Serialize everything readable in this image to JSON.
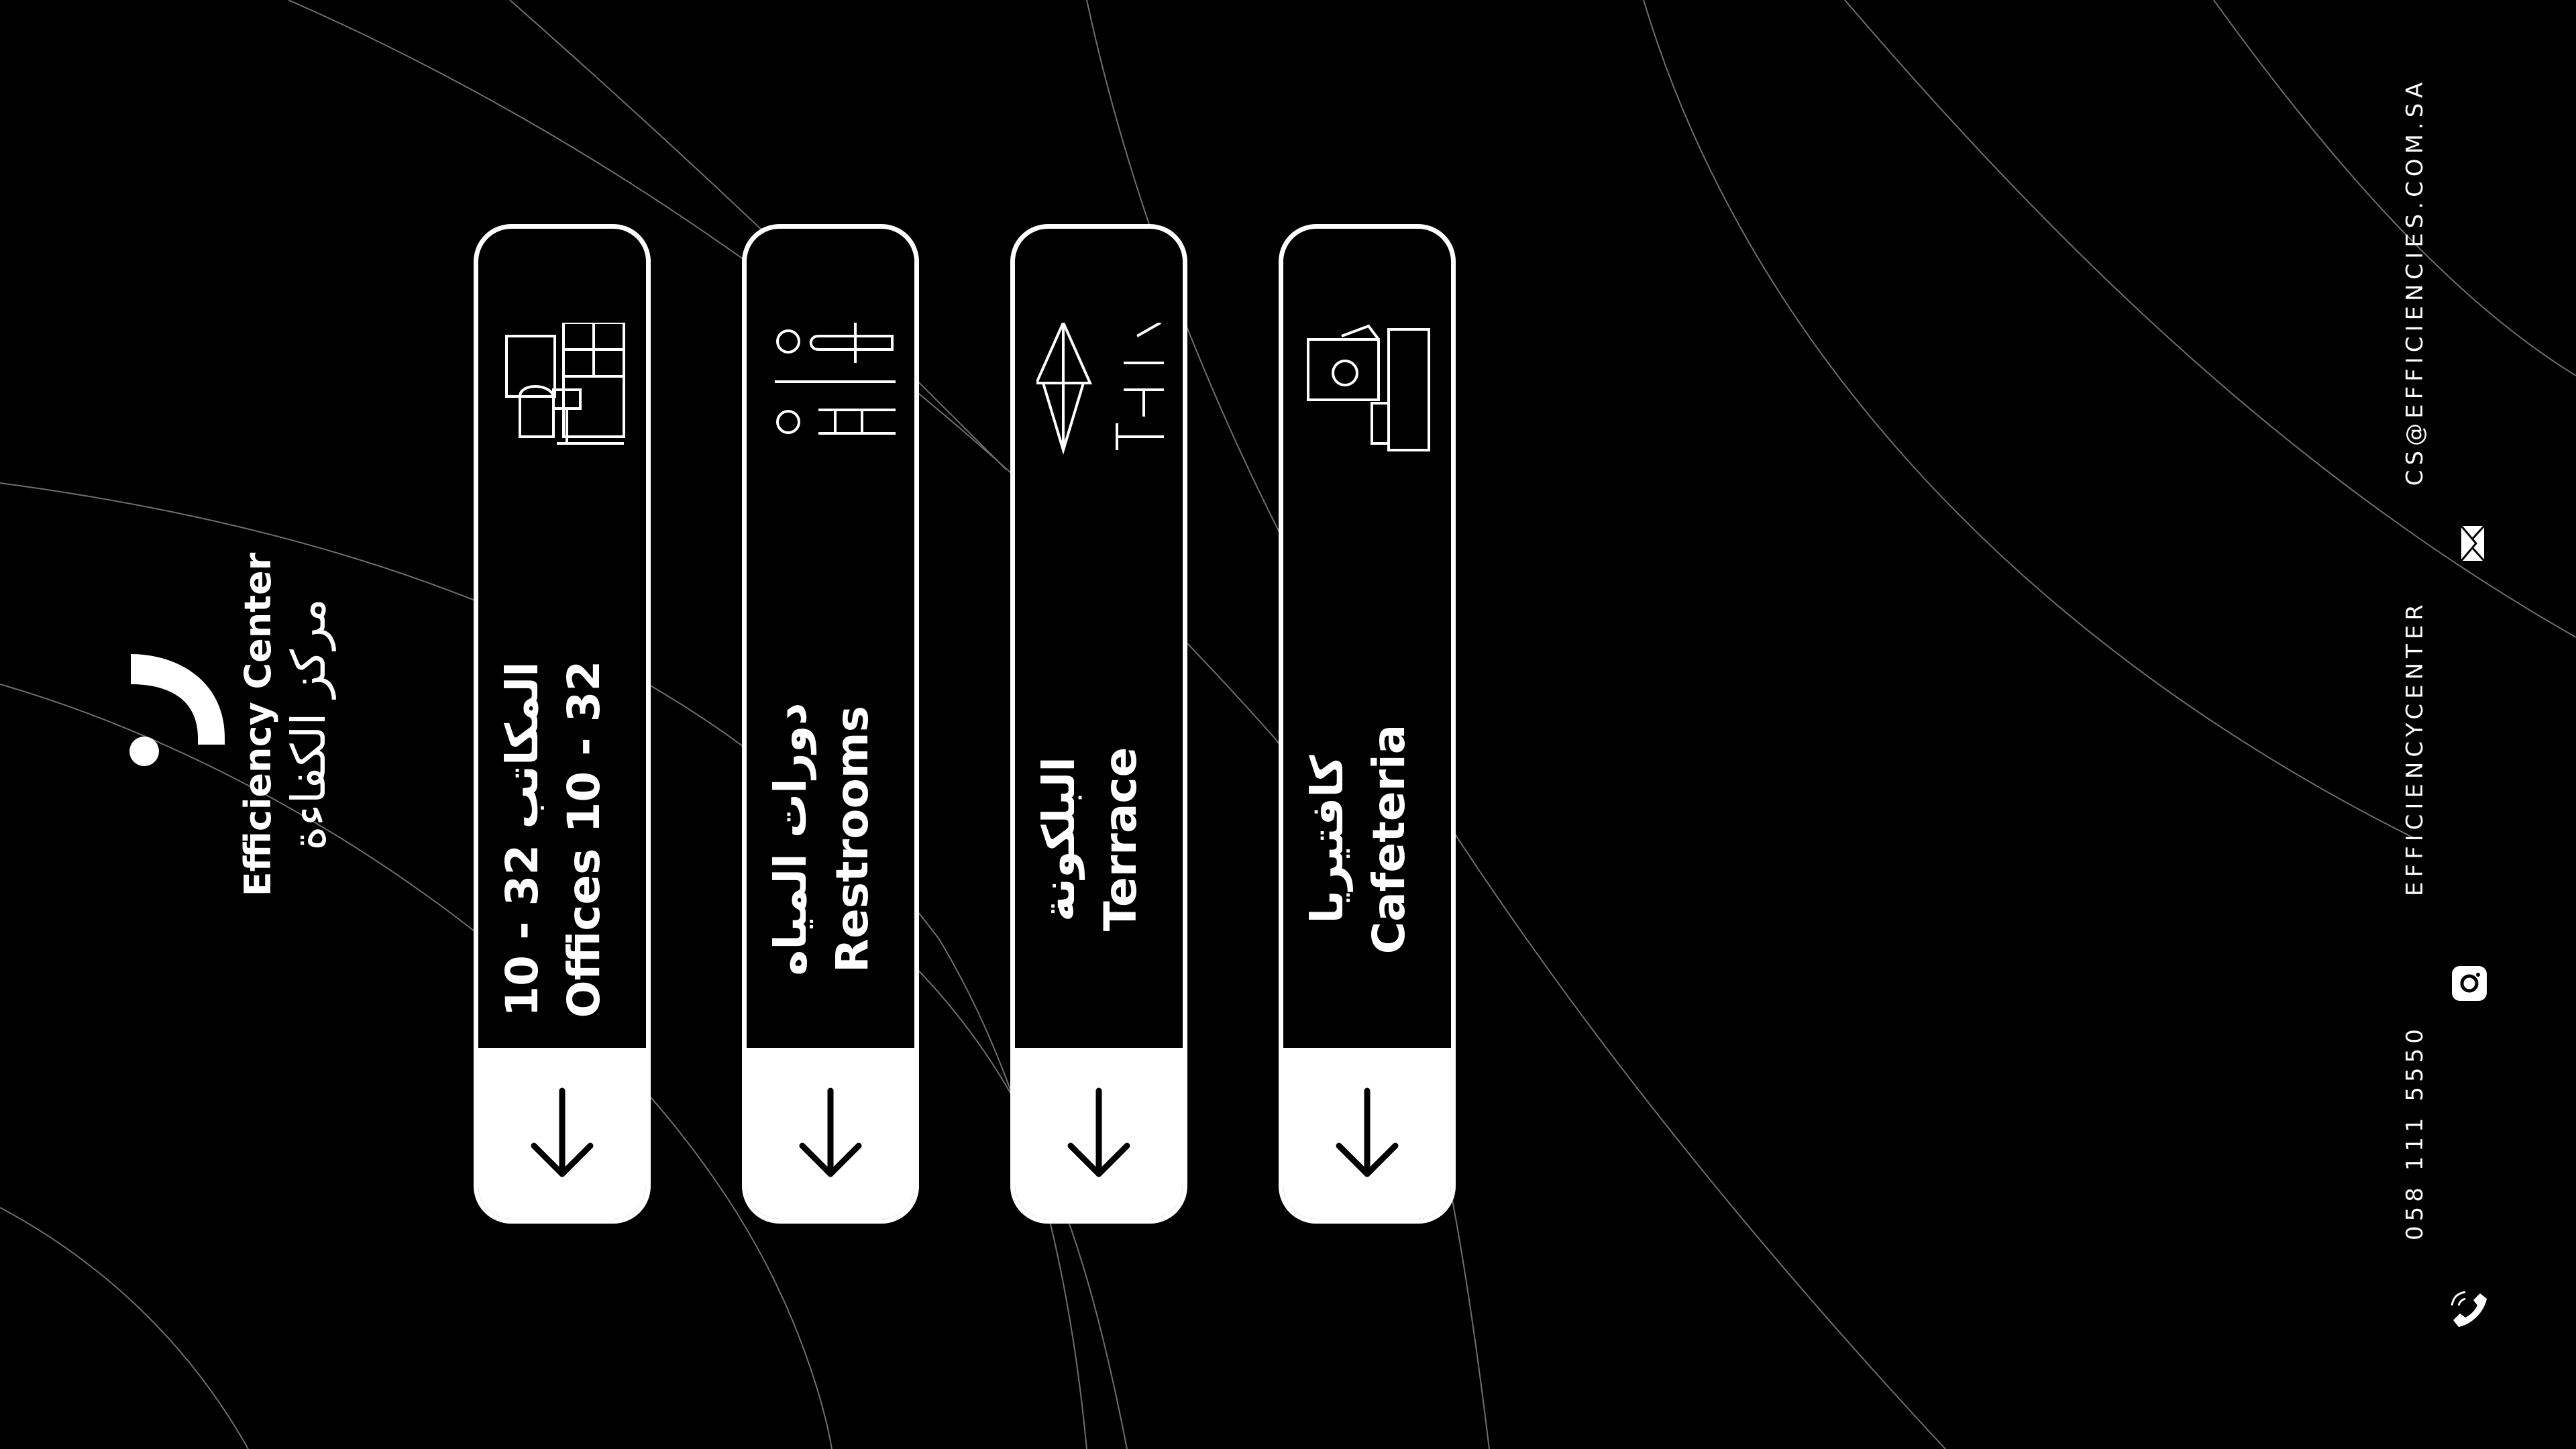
{
  "brand": {
    "name_en": "Efficiency Center",
    "name_ar": "مركز الكفاءة"
  },
  "signs": [
    {
      "label_ar": "المكاتب 32 - 10",
      "label_en": "Offices 10 - 32",
      "icon": "office-desk-icon",
      "direction": "down-arrow-icon"
    },
    {
      "label_ar": "دورات المياه",
      "label_en": "Restrooms",
      "icon": "restroom-icon",
      "direction": "down-arrow-icon"
    },
    {
      "label_ar": "البلكونة",
      "label_en": "Terrace",
      "icon": "terrace-umbrella-icon",
      "direction": "down-arrow-icon"
    },
    {
      "label_ar": "كافتيريا",
      "label_en": "Cafeteria",
      "icon": "cafeteria-icon",
      "direction": "down-arrow-icon"
    }
  ],
  "contact": {
    "email": "CS@EFFICIENCIES.COM.SA",
    "instagram": "EFFICIENCYCENTER",
    "phone": "058 111 5550",
    "icons": [
      "mail-icon",
      "instagram-icon",
      "phone-icon"
    ]
  },
  "colors": {
    "background": "#000000",
    "foreground": "#ffffff",
    "lines": "#7a7a7a"
  }
}
